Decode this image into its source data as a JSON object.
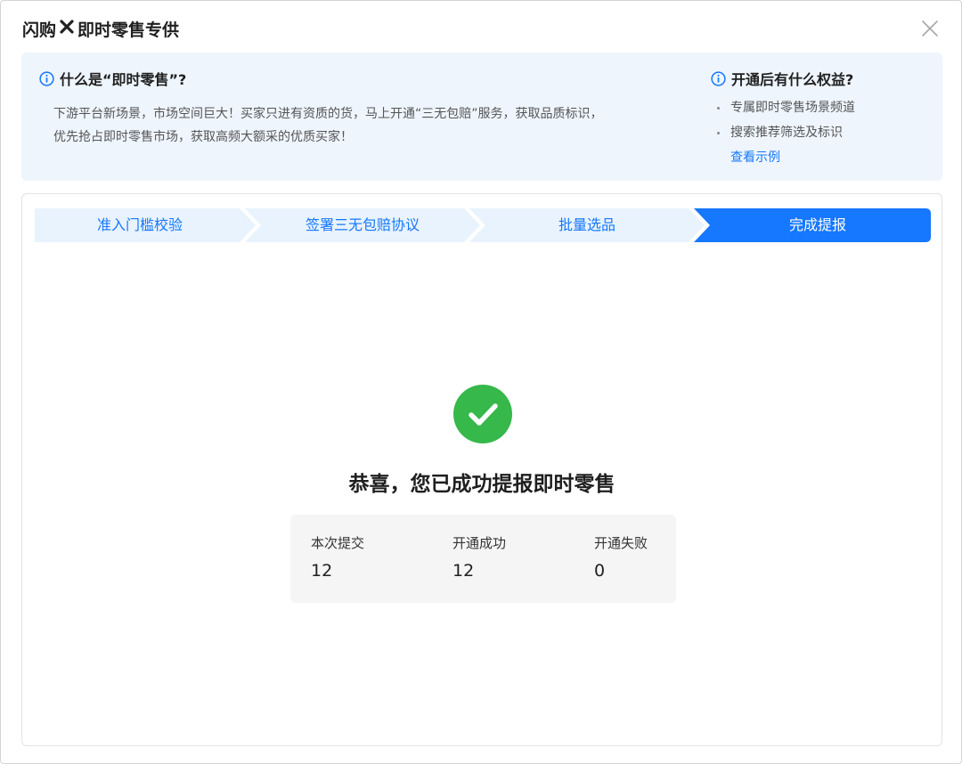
{
  "header": {
    "title_prefix": "闪购",
    "title_suffix": "即时零售专供",
    "close_icon": "close-icon"
  },
  "banner": {
    "left_heading": "什么是“即时零售”?",
    "left_desc_line1": "下游平台新场景，市场空间巨大！买家只进有资质的货，马上开通“三无包赔”服务，获取品质标识，",
    "left_desc_line2": "优先抢占即时零售市场，获取高频大额采的优质买家！",
    "right_heading": "开通后有什么权益?",
    "benefits": [
      "专属即时零售场景频道",
      "搜索推荐筛选及标识"
    ],
    "example_link": "查看示例",
    "link_color": "#1677ff",
    "background_color": "#eef5fd"
  },
  "steps": {
    "items": [
      {
        "label": "准入门槛校验",
        "state": "done"
      },
      {
        "label": "签署三无包赔协议",
        "state": "done"
      },
      {
        "label": "批量选品",
        "state": "done"
      },
      {
        "label": "完成提报",
        "state": "active"
      }
    ],
    "active_color": "#1677ff",
    "inactive_color": "#e8f3fe"
  },
  "result": {
    "icon": "check-circle-icon",
    "icon_color": "#36b84a",
    "title": "恭喜，您已成功提报即时零售",
    "stats": [
      {
        "label": "本次提交",
        "value": "12"
      },
      {
        "label": "开通成功",
        "value": "12"
      },
      {
        "label": "开通失败",
        "value": "0"
      }
    ]
  }
}
